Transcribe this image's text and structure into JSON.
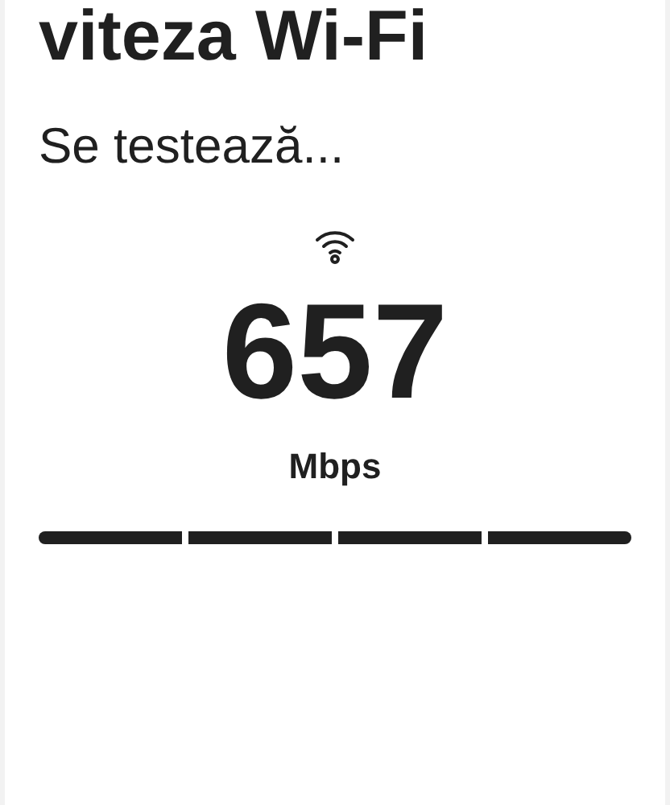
{
  "title": "viteza Wi-Fi",
  "status": "Se testează...",
  "speed": {
    "value": "657",
    "unit": "Mbps"
  },
  "progress": {
    "level": 1
  }
}
